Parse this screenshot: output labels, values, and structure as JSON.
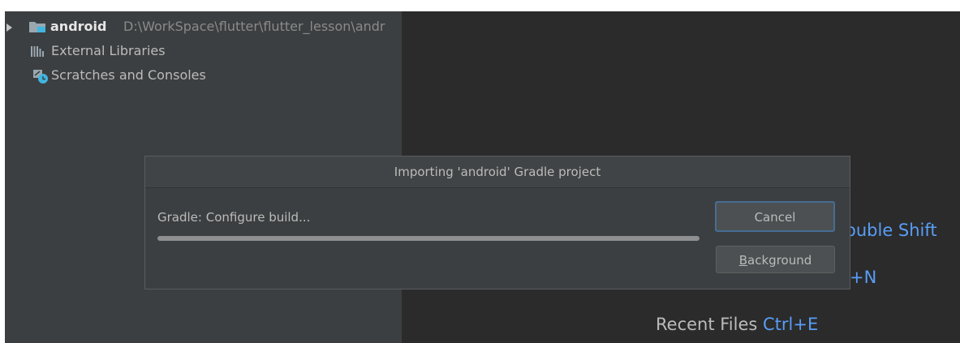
{
  "project_tree": {
    "root": {
      "name": "android",
      "path": "D:\\WorkSpace\\flutter\\flutter_lesson\\andr"
    },
    "items": [
      {
        "label": "External Libraries",
        "icon": "library-icon"
      },
      {
        "label": "Scratches and Consoles",
        "icon": "scratch-icon"
      }
    ]
  },
  "editor_hints": {
    "search_everywhere_fragment": "ouble Shift",
    "new_fragment": "+N",
    "recent_files_label": "Recent Files",
    "recent_files_key": "Ctrl+E"
  },
  "dialog": {
    "title": "Importing 'android' Gradle project",
    "status": "Gradle: Configure build...",
    "progress": 1.0,
    "cancel_label": "Cancel",
    "background_mnemonic": "B",
    "background_rest": "ackground"
  },
  "colors": {
    "panel_bg": "#3c3f41",
    "editor_bg": "#2b2b2b",
    "link_blue": "#589df6",
    "focus_border": "#466d94"
  }
}
